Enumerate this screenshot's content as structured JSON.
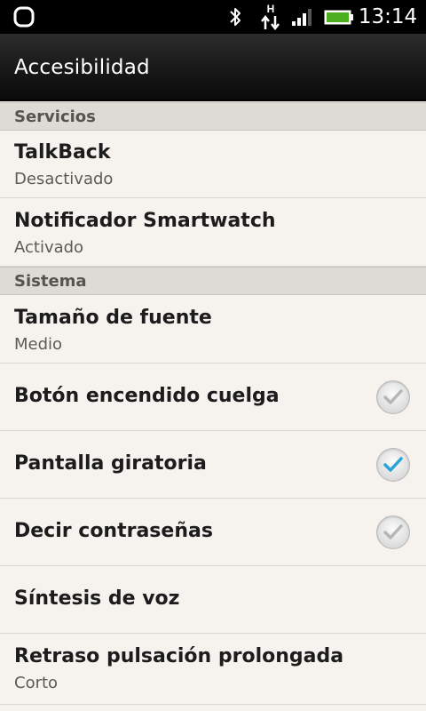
{
  "status_bar": {
    "time": "13:14",
    "data_indicator": "H",
    "icons": [
      "app-notification-icon",
      "bluetooth-icon",
      "data-transfer-icon",
      "signal-icon",
      "battery-icon"
    ],
    "battery_color": "#4caf1e"
  },
  "header": {
    "title": "Accesibilidad"
  },
  "sections": [
    {
      "label": "Servicios"
    },
    {
      "label": "Sistema"
    }
  ],
  "items": [
    {
      "title": "TalkBack",
      "subtitle": "Desactivado"
    },
    {
      "title": "Notificador Smartwatch",
      "subtitle": "Activado"
    },
    {
      "title": "Tamaño de fuente",
      "subtitle": "Medio"
    },
    {
      "title": "Botón encendido cuelga",
      "checked": false
    },
    {
      "title": "Pantalla giratoria",
      "checked": true
    },
    {
      "title": "Decir contraseñas",
      "checked": false
    },
    {
      "title": "Síntesis de voz"
    },
    {
      "title": "Retraso pulsación prolongada",
      "subtitle": "Corto"
    }
  ],
  "colors": {
    "check_on": "#2aa3d6",
    "check_off": "#b6b6b6"
  }
}
